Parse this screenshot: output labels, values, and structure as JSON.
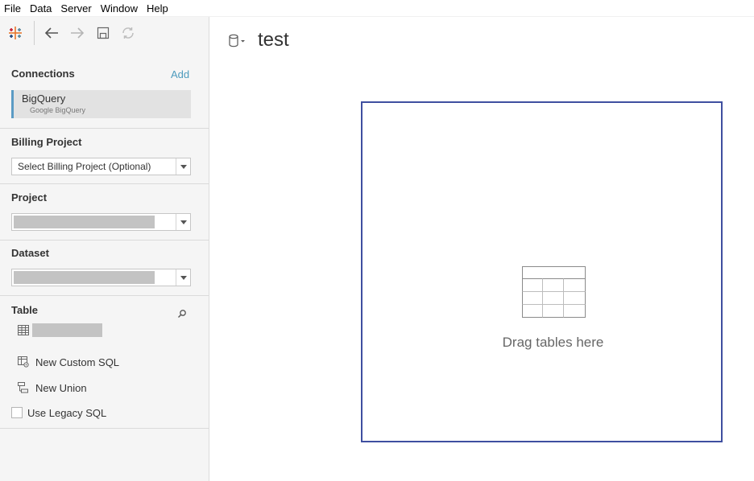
{
  "menu": [
    "File",
    "Data",
    "Server",
    "Window",
    "Help"
  ],
  "toolbar": {
    "icons": [
      "tableau-logo-icon",
      "back-arrow-icon",
      "forward-arrow-icon",
      "save-icon",
      "refresh-icon"
    ]
  },
  "connections": {
    "title": "Connections",
    "add_label": "Add",
    "items": [
      {
        "name": "BigQuery",
        "type": "Google BigQuery"
      }
    ]
  },
  "billing_project": {
    "title": "Billing Project",
    "selected": "Select Billing Project (Optional)"
  },
  "project": {
    "title": "Project"
  },
  "dataset": {
    "title": "Dataset"
  },
  "table": {
    "title": "Table",
    "new_custom_sql": "New Custom SQL",
    "new_union": "New Union",
    "use_legacy_sql": "Use Legacy SQL"
  },
  "datasource": {
    "title": "test"
  },
  "canvas": {
    "drop_label": "Drag tables here"
  },
  "colors": {
    "accent": "#4d9bbd",
    "dropzone_border": "#3f4fa0",
    "selection_bar": "#5b9bc4"
  }
}
